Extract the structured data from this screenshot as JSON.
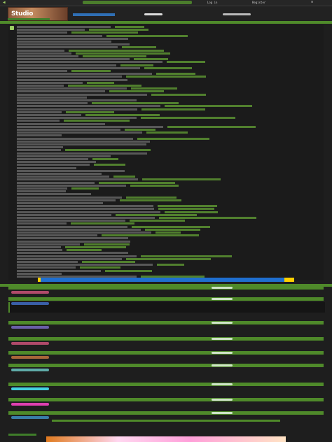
{
  "topbar": {
    "back_label": "◀",
    "logout_label": "Log in",
    "register_label": "Register",
    "menu_label": "≡"
  },
  "header": {
    "logo_text": "Studio",
    "thread_title": ""
  },
  "thread": {
    "bar_label": "",
    "reply_count": ""
  },
  "banner": {
    "text": ""
  },
  "code": {
    "text": ""
  },
  "replies": [
    {
      "name": "",
      "meta": "",
      "text": "",
      "accent": "#b04a6a"
    },
    {
      "name": "",
      "meta": "",
      "text": "",
      "accent": "#3a5fa8"
    },
    {
      "name": "",
      "meta": "",
      "text": "",
      "accent": "#6a5fa8"
    },
    {
      "name": "",
      "meta": "",
      "text": "",
      "accent": "#b04a6a"
    },
    {
      "name": "",
      "meta": "",
      "text": "",
      "accent": "#a8663a"
    },
    {
      "name": "",
      "meta": "",
      "text": "",
      "accent": "#5faba8"
    },
    {
      "name": "",
      "meta": "",
      "text": "",
      "accent": "#43d0e0"
    },
    {
      "name": "",
      "meta": "",
      "text": "",
      "accent": "#e040b0"
    },
    {
      "name": "",
      "meta": "",
      "text": "",
      "accent": "#3a7da8"
    }
  ],
  "colors": {
    "bar_green": "#4f8a2a",
    "text_green": "#5f9a33",
    "banner_blue": "#1f6fd0",
    "banner_yellow": "#ffd000"
  }
}
